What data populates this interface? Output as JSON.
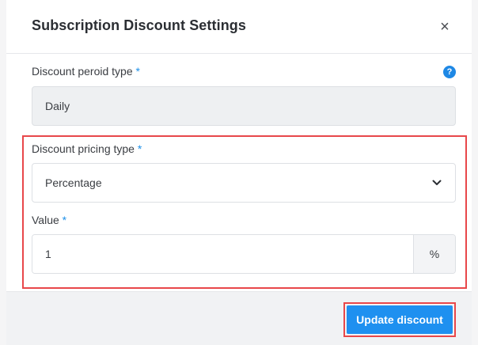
{
  "dialog": {
    "title": "Subscription Discount Settings",
    "close_symbol": "×"
  },
  "period": {
    "label": "Discount peroid type",
    "required_mark": "*",
    "help_symbol": "?",
    "value": "Daily"
  },
  "pricing": {
    "label": "Discount pricing type",
    "required_mark": "*",
    "selected": "Percentage"
  },
  "amount": {
    "label": "Value",
    "required_mark": "*",
    "value": "1",
    "suffix": "%"
  },
  "footer": {
    "update_label": "Update discount"
  },
  "colors": {
    "accent": "#1e90f0",
    "highlight": "#e8474a",
    "required": "#1e90e8"
  }
}
